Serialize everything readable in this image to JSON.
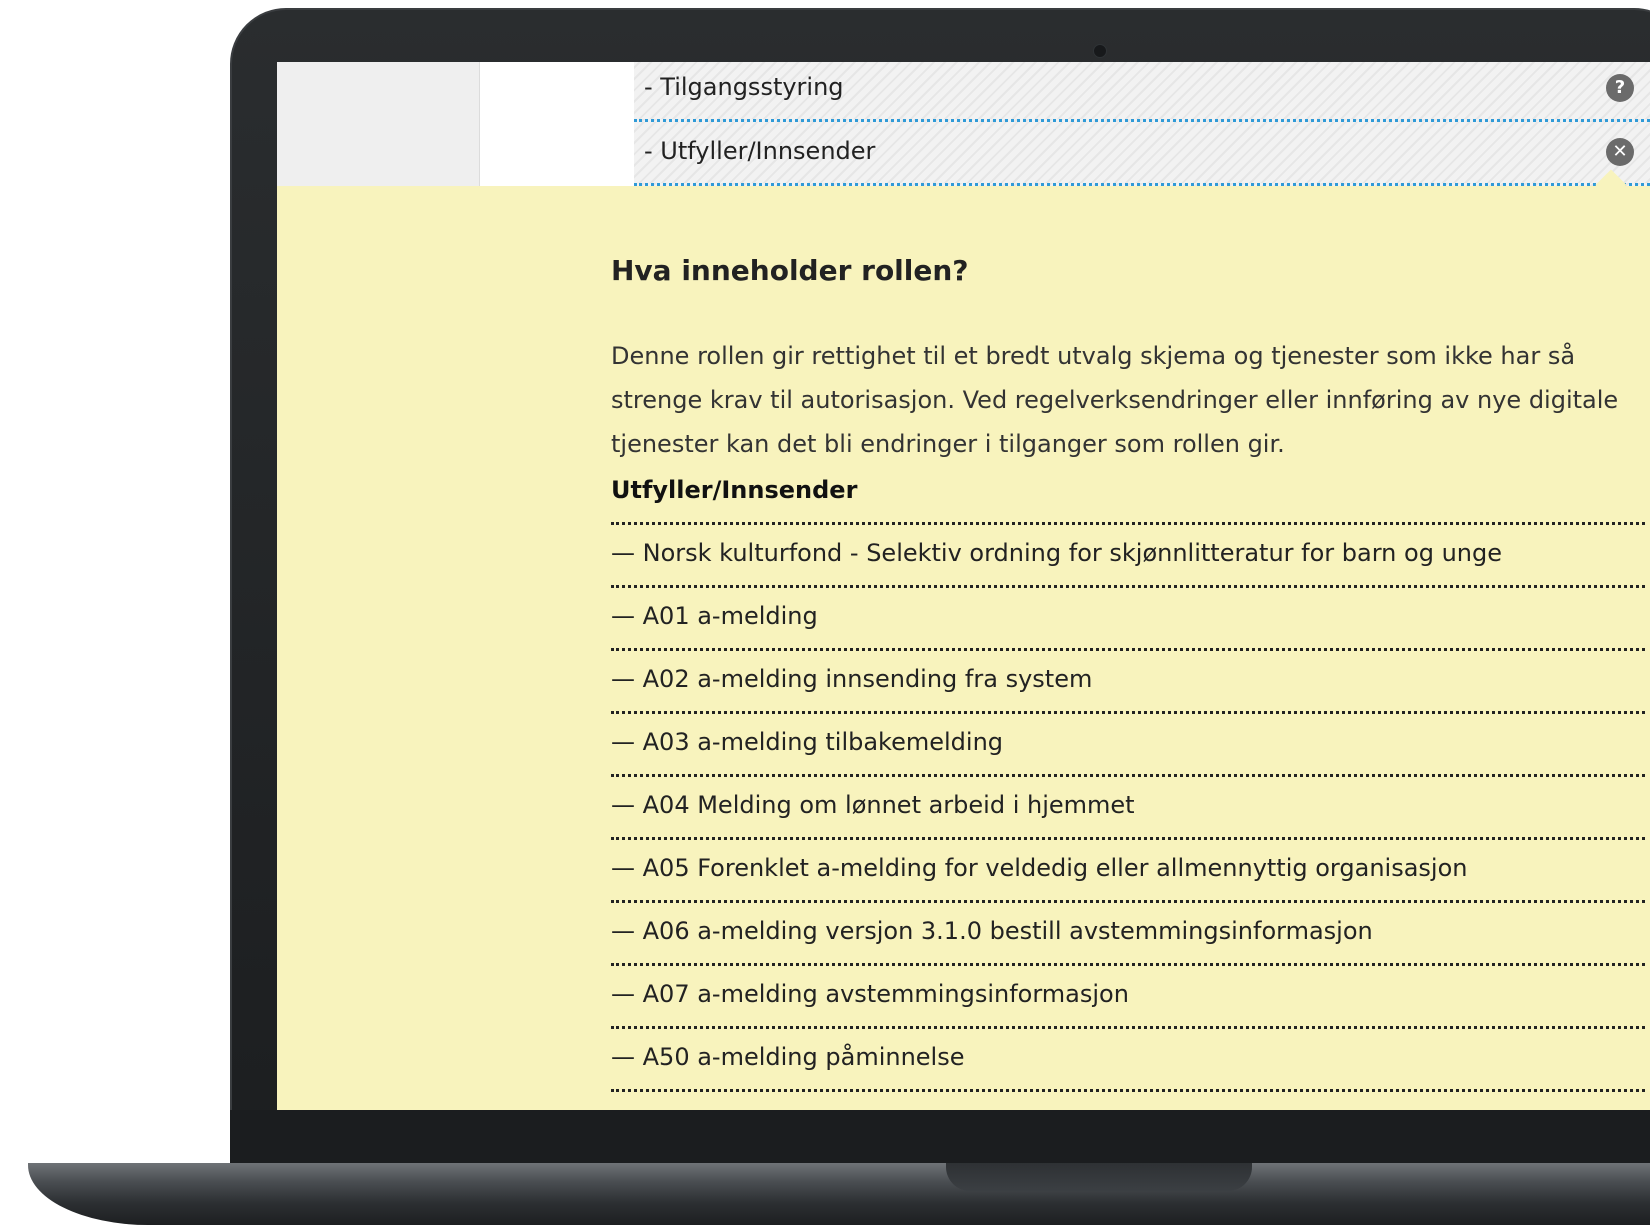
{
  "roles": [
    {
      "label": "- Tilgangsstyring",
      "icon": "help-icon",
      "icon_glyph": "?"
    },
    {
      "label": "- Utfyller/Innsender",
      "icon": "close-icon",
      "icon_glyph": "✕"
    }
  ],
  "panel": {
    "title": "Hva inneholder rollen?",
    "description": "Denne rollen gir rettighet til et bredt utvalg skjema og tjenester som ikke har så strenge krav til autorisasjon. Ved regelverksendringer eller innføring av nye digitale tjenester kan det bli endringer i tilganger som rollen gir.",
    "group_title": "Utfyller/Innsender",
    "services": [
      "— Norsk kulturfond - Selektiv ordning for skjønnlitteratur for barn og unge",
      "— A01 a-melding",
      "— A02 a-melding innsending fra system",
      "— A03 a-melding tilbakemelding",
      "— A04 Melding om lønnet arbeid i hjemmet",
      "— A05 Forenklet a-melding for veldedig eller allmennyttig organisasjon",
      "— A06 a-melding versjon 3.1.0 bestill avstemmingsinformasjon",
      "— A07 a-melding avstemmingsinformasjon",
      "— A50 a-melding påminnelse"
    ]
  },
  "colors": {
    "panel_background": "#f8f3bd",
    "row_border": "#2f9ad7",
    "icon_background": "#6b6b6b"
  }
}
